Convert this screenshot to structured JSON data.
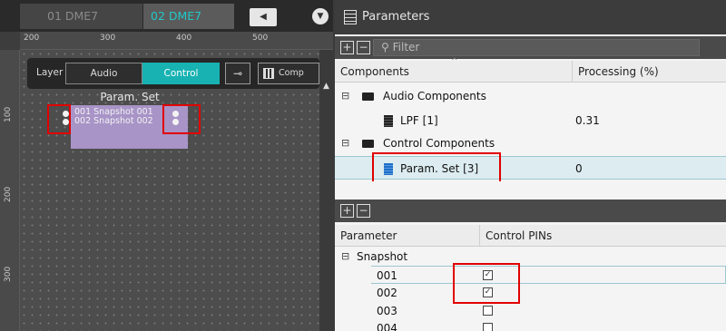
{
  "left": {
    "tabs": [
      {
        "label": "01 DME7"
      },
      {
        "label": "02 DME7"
      }
    ],
    "ruler": {
      "top": [
        "200",
        "300",
        "400",
        "500"
      ],
      "left": [
        "100",
        "200",
        "300"
      ]
    },
    "layer": {
      "label": "Layer",
      "audio": "Audio",
      "control": "Control",
      "components_btn": "Comp"
    },
    "component": {
      "title": "Param. Set",
      "rows": [
        {
          "label": "001 Snapshot 001"
        },
        {
          "label": "002 Snapshot 002"
        }
      ]
    }
  },
  "right": {
    "title": "Parameters",
    "filter_placeholder": "Filter",
    "components_table": {
      "headers": [
        "Components",
        "Processing (%)"
      ],
      "groups": [
        {
          "name": "Audio Components",
          "items": [
            {
              "name": "LPF [1]",
              "value": "0.31"
            }
          ]
        },
        {
          "name": "Control Components",
          "items": [
            {
              "name": "Param. Set [3]",
              "value": "0"
            }
          ]
        }
      ]
    },
    "parameter_table": {
      "headers": [
        "Parameter",
        "Control PINs"
      ],
      "group": "Snapshot",
      "rows": [
        {
          "name": "001",
          "checked": true
        },
        {
          "name": "002",
          "checked": true
        },
        {
          "name": "003",
          "checked": false
        },
        {
          "name": "004",
          "checked": false
        }
      ]
    }
  },
  "colors": {
    "accent_cyan": "#18b2b2",
    "component_fill": "#a894c7",
    "highlight_red": "#e10000",
    "selected_chip": "#1e6fc7"
  }
}
